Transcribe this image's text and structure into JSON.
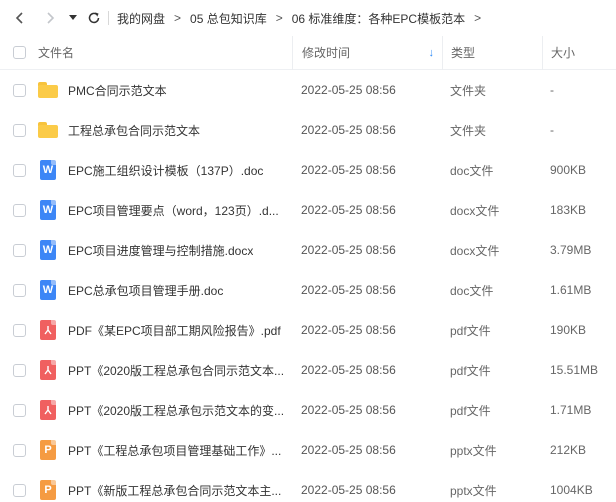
{
  "colors": {
    "word": "#3d86f6",
    "pdf": "#f06060",
    "ppt": "#f59b42",
    "folder": "#fbcb48",
    "accent": "#2e8af7"
  },
  "nav": {
    "back_icon": "chevron-left-icon",
    "forward_icon": "chevron-right-icon",
    "history_icon": "caret-down-icon",
    "refresh_icon": "refresh-icon",
    "breadcrumbs": [
      "我的网盘",
      "05 总包知识库",
      "06 标准维度：各种EPC模板范本"
    ],
    "separator": ">"
  },
  "header": {
    "name": "文件名",
    "time": "修改时间",
    "sort_arrow": "↓",
    "type": "类型",
    "size": "大小"
  },
  "files": [
    {
      "icon": "folder",
      "name": "PMC合同示范文本",
      "time": "2022-05-25 08:56",
      "type": "文件夹",
      "size": "-"
    },
    {
      "icon": "folder",
      "name": "工程总承包合同示范文本",
      "time": "2022-05-25 08:56",
      "type": "文件夹",
      "size": "-"
    },
    {
      "icon": "word",
      "name": "EPC施工组织设计模板（137P）.doc",
      "time": "2022-05-25 08:56",
      "type": "doc文件",
      "size": "900KB"
    },
    {
      "icon": "word",
      "name": "EPC项目管理要点（word，123页）.d...",
      "time": "2022-05-25 08:56",
      "type": "docx文件",
      "size": "183KB"
    },
    {
      "icon": "word",
      "name": "EPC项目进度管理与控制措施.docx",
      "time": "2022-05-25 08:56",
      "type": "docx文件",
      "size": "3.79MB"
    },
    {
      "icon": "word",
      "name": "EPC总承包项目管理手册.doc",
      "time": "2022-05-25 08:56",
      "type": "doc文件",
      "size": "1.61MB"
    },
    {
      "icon": "pdf",
      "name": "PDF《某EPC项目部工期风险报告》.pdf",
      "time": "2022-05-25 08:56",
      "type": "pdf文件",
      "size": "190KB"
    },
    {
      "icon": "pdf",
      "name": "PPT《2020版工程总承包合同示范文本...",
      "time": "2022-05-25 08:56",
      "type": "pdf文件",
      "size": "15.51MB"
    },
    {
      "icon": "pdf",
      "name": "PPT《2020版工程总承包示范文本的变...",
      "time": "2022-05-25 08:56",
      "type": "pdf文件",
      "size": "1.71MB"
    },
    {
      "icon": "ppt",
      "name": "PPT《工程总承包项目管理基础工作》...",
      "time": "2022-05-25 08:56",
      "type": "pptx文件",
      "size": "212KB"
    },
    {
      "icon": "ppt",
      "name": "PPT《新版工程总承包合同示范文本主...",
      "time": "2022-05-25 08:56",
      "type": "pptx文件",
      "size": "1004KB"
    }
  ]
}
